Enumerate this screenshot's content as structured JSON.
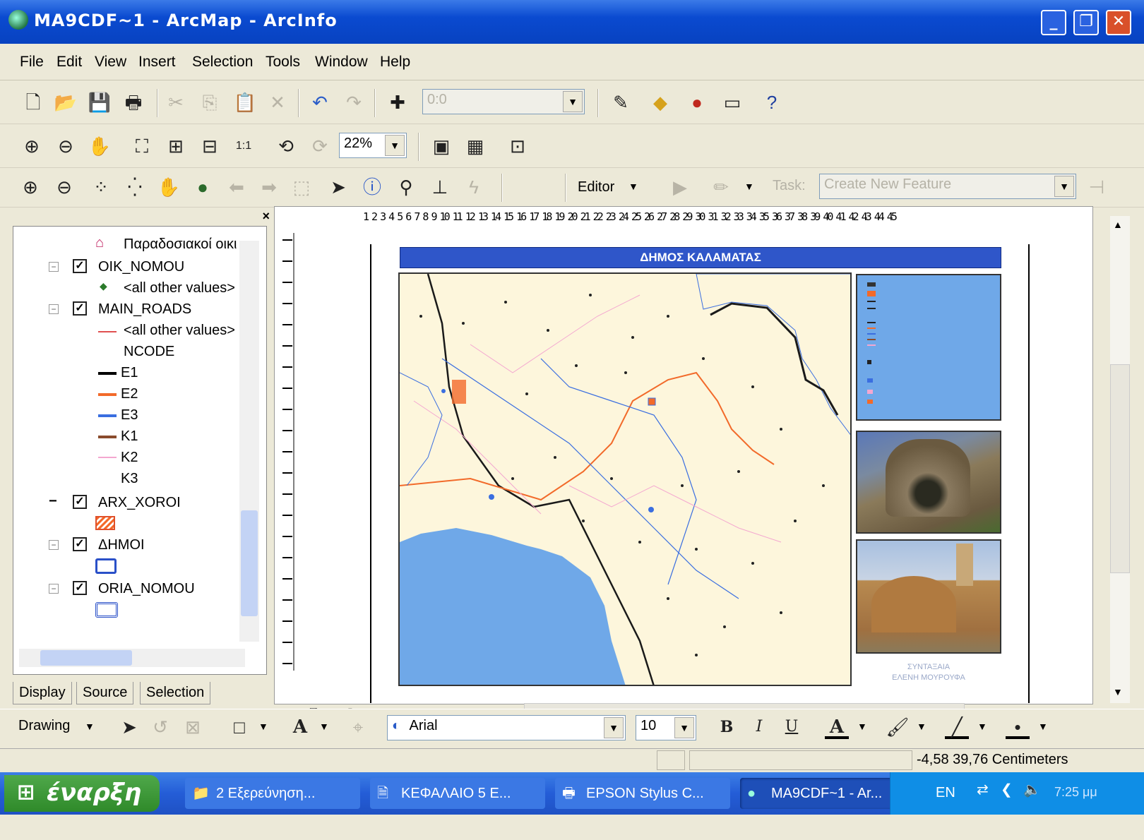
{
  "window": {
    "title": "MA9CDF~1 - ArcMap - ArcInfo",
    "min_label": "_",
    "max_label": "❐",
    "close_label": "✕"
  },
  "menu": [
    "File",
    "Edit",
    "View",
    "Insert",
    "Selection",
    "Tools",
    "Window",
    "Help"
  ],
  "standard_toolbar": {
    "scale_value": "0:0"
  },
  "layout_toolbar": {
    "zoom_value": "22%"
  },
  "editor_toolbar": {
    "editor_label": "Editor",
    "task_label": "Task:",
    "task_value": "Create New Feature"
  },
  "toc": {
    "top_item": "Παραδοσιακοί οικι",
    "layers": [
      {
        "name": "OIK_NOMOU",
        "checked": true,
        "sub": "<all other values>"
      },
      {
        "name": "MAIN_ROADS",
        "checked": true,
        "sub": "<all other values>",
        "field": "NCODE",
        "classes": [
          {
            "label": "E1",
            "color": "#000000"
          },
          {
            "label": "E2",
            "color": "#f26a2a"
          },
          {
            "label": "E3",
            "color": "#3a6ee0"
          },
          {
            "label": "K1",
            "color": "#8a4b2c"
          },
          {
            "label": "K2",
            "color": "#f4a7d0"
          },
          {
            "label": "K3",
            "color": "#ffffff"
          }
        ]
      },
      {
        "name": "ARX_XOROI",
        "checked": true
      },
      {
        "name": "ΔΗΜΟΙ",
        "checked": true
      },
      {
        "name": "ORIA_NOMOU",
        "checked": true
      }
    ],
    "tabs": [
      "Display",
      "Source",
      "Selection"
    ]
  },
  "layout": {
    "map_title": "ΔΗΜΟΣ ΚΑΛΑΜΑΤΑΣ",
    "credit_line1": "ΣΥΝΤΑΞΑΙΑ",
    "credit_line2": "ΕΛΕΝΗ ΜΟΥΡΟΥΦΑ",
    "ruler_text": "1 2 3 4 5 6 7 8 9 10 11 12 13 14 15 16 17 18 19 20 21 22 23 24 25 26 27 28 29 30 31 32 33 34 35 36 37 38 39 40 41 42 43 44 45"
  },
  "drawing_toolbar": {
    "drawing_label": "Drawing",
    "font_value": "Arial",
    "size_value": "10",
    "bold": "B",
    "italic": "I",
    "underline": "U"
  },
  "status": {
    "coords": "-4,58  39,76 Centimeters"
  },
  "taskbar": {
    "start": "έναρξη",
    "tasks": [
      "2 Εξερεύνηση...",
      "ΚΕΦΑΛΑΙΟ 5 Ε...",
      "EPSON Stylus C...",
      "MA9CDF~1 - Ar..."
    ],
    "lang": "EN",
    "clock": "7:25 μμ"
  },
  "colors": {
    "title_blue": "#0a4ad0",
    "map_sea": "#6fa8e8",
    "map_land": "#fdf6dc",
    "map_title_bar": "#2f56c9"
  }
}
